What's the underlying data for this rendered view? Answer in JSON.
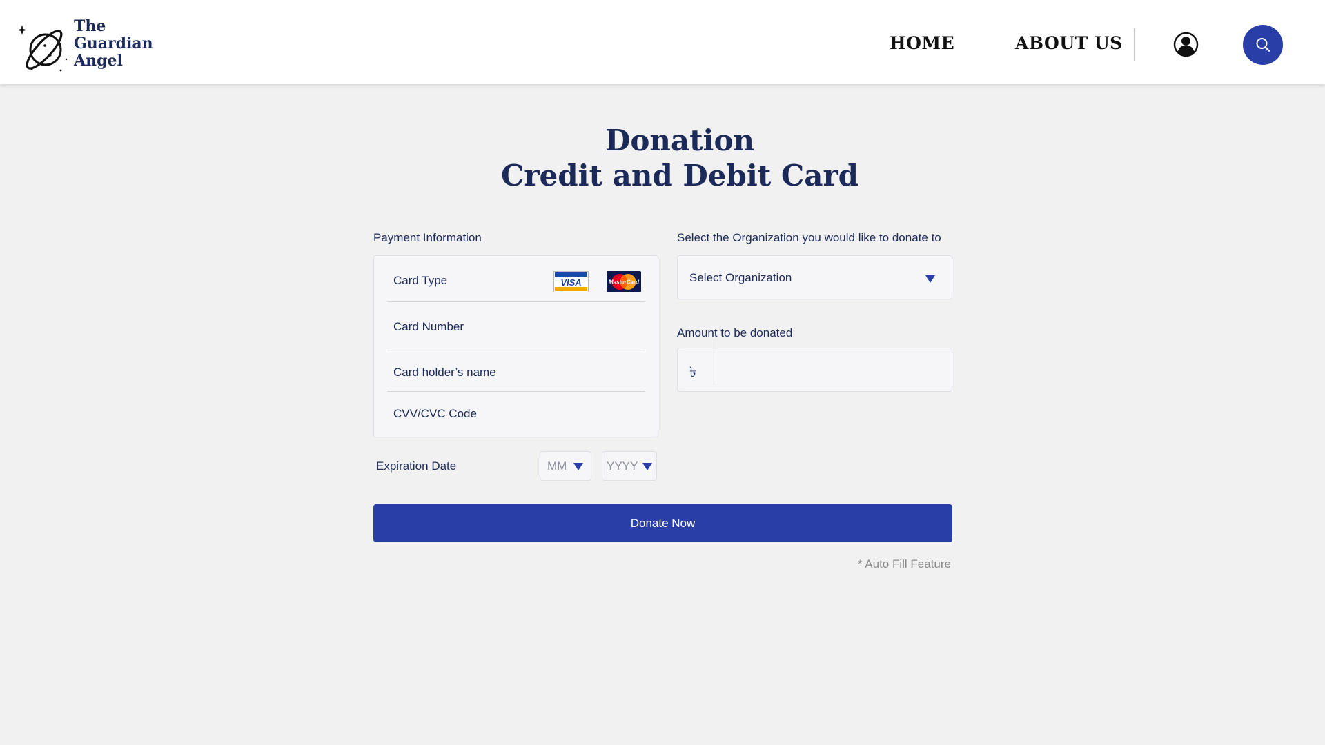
{
  "brand": {
    "name_line1": "The",
    "name_line2": "Guardian",
    "name_line3": "Angel"
  },
  "nav": {
    "home": "HOME",
    "about": "ABOUT US"
  },
  "icons": {
    "profile": "user-profile-icon",
    "search": "search-icon",
    "logo": "planet-logo-icon"
  },
  "title": {
    "line1": "Donation",
    "line2": "Credit and Debit Card"
  },
  "payment": {
    "section_label": "Payment Information",
    "card_type": "Card Type",
    "card_number": "Card Number",
    "card_holder": "Card holder’s name",
    "cvv": "CVV/CVC Code",
    "visa_text": "VISA",
    "mastercard_text": "MasterCard"
  },
  "expiration": {
    "label": "Expiration Date",
    "month_placeholder": "MM",
    "year_placeholder": "YYYY"
  },
  "organization": {
    "label": "Select the Organization you would like to donate to",
    "selected": "Select Organization"
  },
  "amount": {
    "label": "Amount to be donated",
    "currency_symbol": "৳",
    "value": ""
  },
  "actions": {
    "donate": "Donate Now",
    "autofill_note": "* Auto Fill Feature"
  },
  "colors": {
    "primary": "#2a3ea8",
    "navy_text": "#1c2a5a",
    "background": "#f1f1f1",
    "field_bg": "#f6f6f9"
  }
}
